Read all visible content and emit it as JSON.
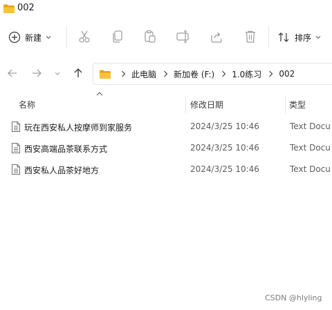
{
  "window": {
    "title": "002"
  },
  "toolbar": {
    "new_label": "新建",
    "sort_label": "排序",
    "icons": [
      "cut-icon",
      "copy-icon",
      "paste-icon",
      "rename-icon",
      "share-icon",
      "delete-icon"
    ]
  },
  "nav": {
    "breadcrumb": [
      "此电脑",
      "新加卷 (F:)",
      "1.0练习",
      "002"
    ]
  },
  "columns": {
    "name": "名称",
    "date": "修改日期",
    "type": "类型"
  },
  "files": [
    {
      "name": "玩在西安私人按摩师到家服务",
      "date": "2024/3/25 10:46",
      "type": "Text Docu"
    },
    {
      "name": "西安高端品茶联系方式",
      "date": "2024/3/25 10:46",
      "type": "Text Docu"
    },
    {
      "name": "西安私人品茶好地方",
      "date": "2024/3/25 10:46",
      "type": "Text Docu"
    }
  ],
  "watermark": "CSDN @hlyling",
  "colors": {
    "folder": "#F8C33A",
    "folder_dark": "#E8A219",
    "icon_gray": "#8a8a8a"
  }
}
